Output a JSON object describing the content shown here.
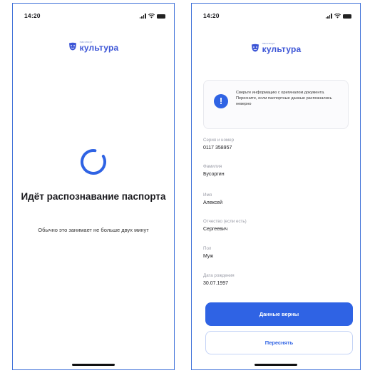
{
  "left": {
    "status_time": "14:20",
    "brand_small": "пасспорт",
    "brand_big": "культура",
    "title": "Идёт распознавание паспорта",
    "subtitle": "Обычно это занимает не больше двух минут"
  },
  "right": {
    "status_time": "14:20",
    "brand_small": "пасспорт",
    "brand_big": "культура",
    "alert_text": "Сверьте информацию с оригиналом документа. Пересните, если паспортные данные распознались неверно",
    "fields": [
      {
        "label": "Серия и номер",
        "value": "0117 358957"
      },
      {
        "label": "Фамилия",
        "value": "Бусоргин"
      },
      {
        "label": "Имя",
        "value": "Алексей"
      },
      {
        "label": "Отчество (если есть)",
        "value": "Сергеевич"
      },
      {
        "label": "Пол",
        "value": "Муж"
      },
      {
        "label": "Дата рождения",
        "value": "30.07.1997"
      }
    ],
    "confirm_label": "Данные верны",
    "retake_label": "Переснять"
  },
  "colors": {
    "accent": "#2f63e4",
    "brand": "#3c55d6",
    "frame": "#3d6fd8"
  }
}
